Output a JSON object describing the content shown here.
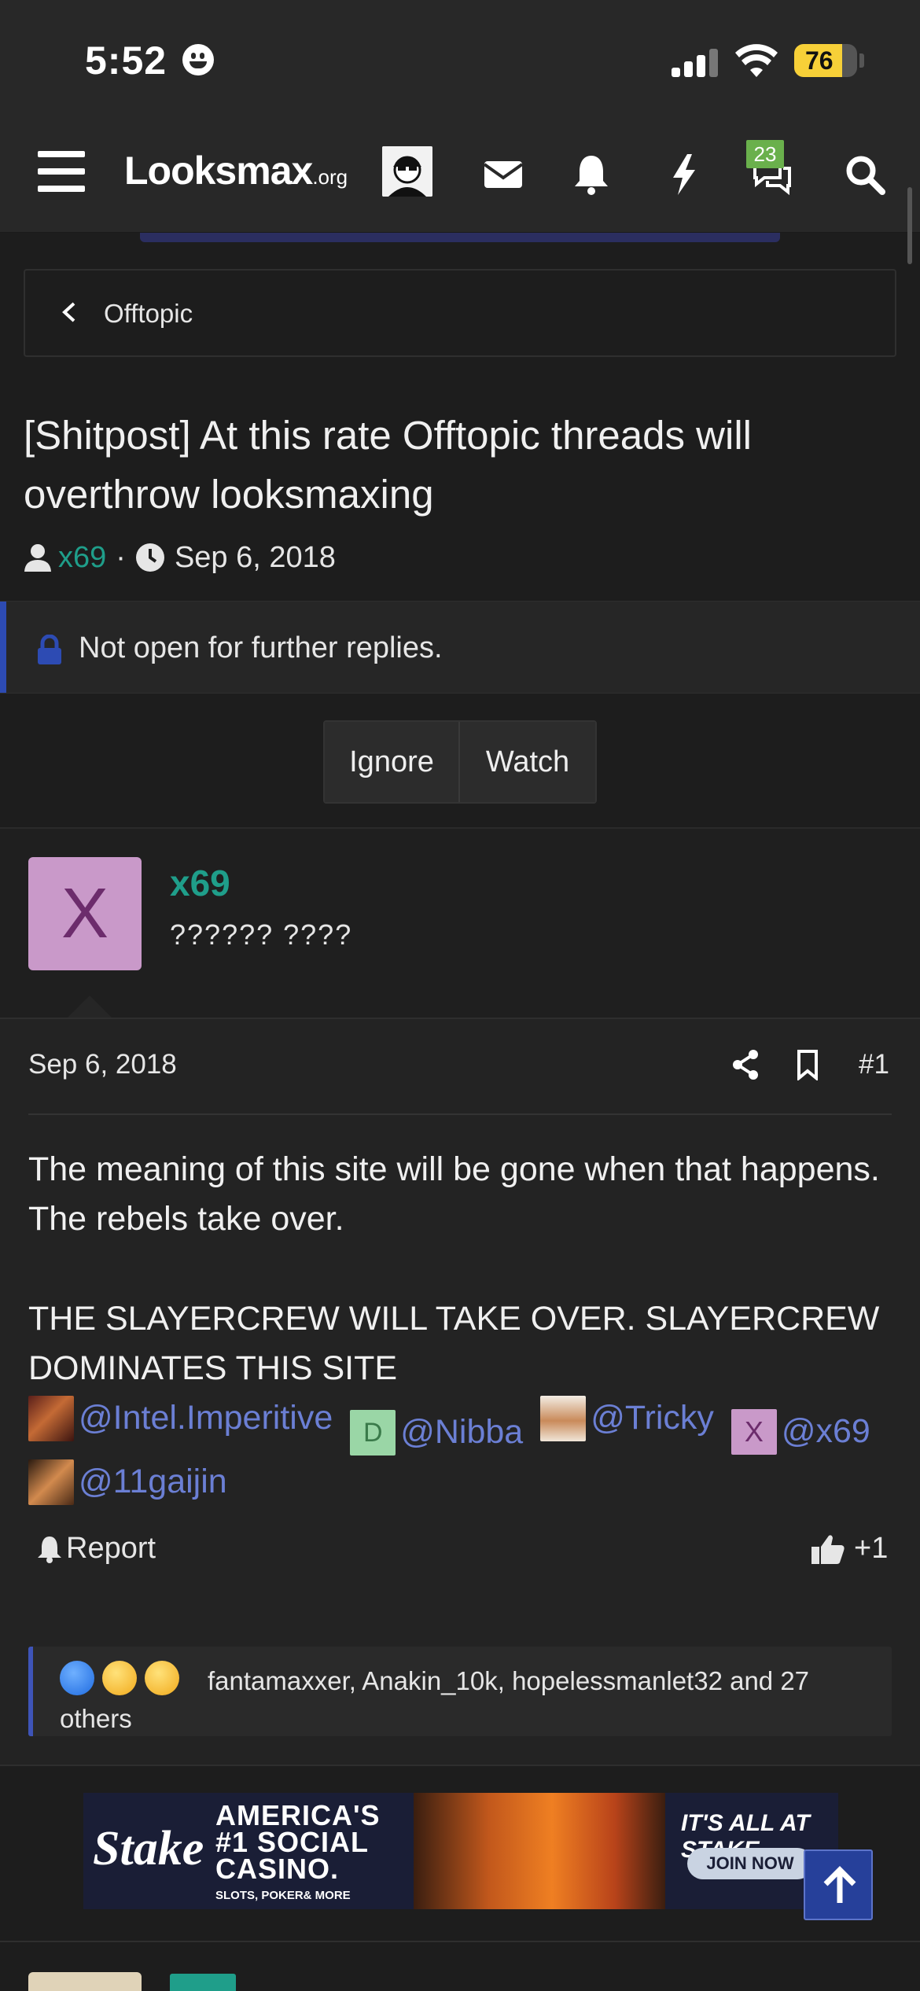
{
  "status_bar": {
    "time": "5:52",
    "battery": "76",
    "battery_level": 0.76
  },
  "navbar": {
    "logo_main": "Looksmax",
    "logo_suffix": ".org",
    "notification_count": "23",
    "icons": [
      "menu-icon",
      "avatar",
      "mail-icon",
      "bell-icon",
      "lightning-icon",
      "chat-icon",
      "search-icon"
    ]
  },
  "breadcrumb": {
    "label": "Offtopic"
  },
  "thread": {
    "title": "[Shitpost] At this rate Offtopic threads will overthrow looksmaxing",
    "author": "x69",
    "separator": "·",
    "date": "Sep 6, 2018"
  },
  "notice": {
    "text": "Not open for further replies."
  },
  "actions": {
    "ignore": "Ignore",
    "watch": "Watch"
  },
  "post": {
    "avatar_letter": "X",
    "username": "x69",
    "user_title": "?????? ????",
    "date": "Sep 6, 2018",
    "number": "#1",
    "paragraph1": "The meaning of this site will be gone when that happens. The rebels take over.",
    "paragraph2": "THE SLAYERCREW WILL TAKE OVER. SLAYERCREW DOMINATES THIS SITE",
    "mentions": [
      {
        "name": "@Intel.Imperitive",
        "avatar": ""
      },
      {
        "name": "@Nibba",
        "avatar": "D"
      },
      {
        "name": "@Tricky",
        "avatar": ""
      },
      {
        "name": "@x69",
        "avatar": "X"
      },
      {
        "name": "@11gaijin",
        "avatar": ""
      }
    ],
    "report": "Report",
    "like": "+1",
    "reactions": {
      "text": "fantamaxxer, Anakin_10k, hopelessmanlet32 and 27 others"
    }
  },
  "ad": {
    "brand": "Stake",
    "headline1": "AMERICA'S",
    "headline2": "#1 SOCIAL",
    "headline3": "CASINO.",
    "sub": "SLOTS, POKER& MORE",
    "tag": "IT'S ALL AT STAKE",
    "cta": "JOIN NOW"
  },
  "colors": {
    "accent_teal": "#1f9e8a",
    "mention_blue": "#6b7fd4",
    "notice_bar": "#2d4bb3",
    "badge_green": "#6ab04c"
  }
}
